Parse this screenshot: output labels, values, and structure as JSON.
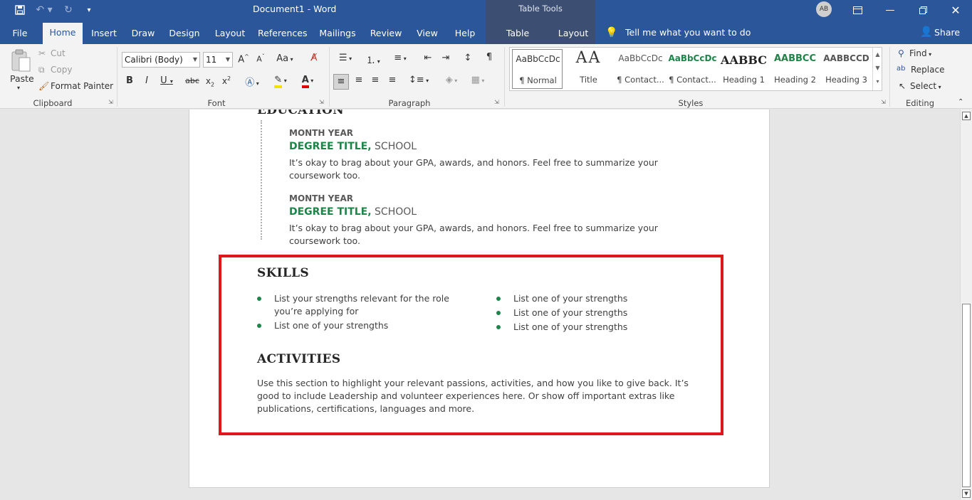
{
  "title_bar": {
    "doc_title": "Document1  -  Word",
    "context_group": "Table Tools",
    "avatar_initials": "AB"
  },
  "tabs": [
    "File",
    "Home",
    "Insert",
    "Draw",
    "Design",
    "Layout",
    "References",
    "Mailings",
    "Review",
    "View",
    "Help",
    "Table Design",
    "Layout"
  ],
  "tell_me": "Tell me what you want to do",
  "share": "Share",
  "clipboard": {
    "paste": "Paste",
    "cut": "Cut",
    "copy": "Copy",
    "format_painter": "Format Painter",
    "label": "Clipboard"
  },
  "font": {
    "name": "Calibri (Body)",
    "size": "11",
    "label": "Font"
  },
  "paragraph": {
    "label": "Paragraph"
  },
  "styles": {
    "label": "Styles",
    "items": [
      {
        "preview": "AaBbCcDc",
        "label": "¶ Normal"
      },
      {
        "preview": "AA",
        "label": "Title"
      },
      {
        "preview": "AaBbCcDc",
        "label": "¶ Contact..."
      },
      {
        "preview": "AaBbCcDc",
        "label": "¶ Contact..."
      },
      {
        "preview": "AABBC",
        "label": "Heading 1"
      },
      {
        "preview": "AABBCC",
        "label": "Heading 2"
      },
      {
        "preview": "AABBCCD",
        "label": "Heading 3"
      }
    ]
  },
  "editing": {
    "find": "Find",
    "replace": "Replace",
    "select": "Select",
    "label": "Editing"
  },
  "document": {
    "education_heading": "EDUCATION",
    "entries": [
      {
        "month": "MONTH YEAR",
        "degree": "DEGREE TITLE,",
        "school": " SCHOOL",
        "desc": "It’s okay to brag about your GPA, awards, and honors. Feel free to summarize your coursework too."
      },
      {
        "month": "MONTH YEAR",
        "degree": "DEGREE TITLE,",
        "school": " SCHOOL",
        "desc": "It’s okay to brag about your GPA, awards, and honors. Feel free to summarize your coursework too."
      }
    ],
    "skills_heading": "SKILLS",
    "skills_left": [
      "List your strengths relevant for the role you’re applying for",
      "List one of your strengths"
    ],
    "skills_right": [
      "List one of your strengths",
      "List one of your strengths",
      "List one of your strengths"
    ],
    "activities_heading": "ACTIVITIES",
    "activities_text": "Use this section to highlight your relevant passions, activities, and how you like to give back. It’s good to include Leadership and volunteer experiences here. Or show off important extras like publications, certifications, languages and more."
  },
  "colors": {
    "ribbon_blue": "#2b579a",
    "accent_green": "#1e8449",
    "highlight_red": "#e0161e"
  }
}
